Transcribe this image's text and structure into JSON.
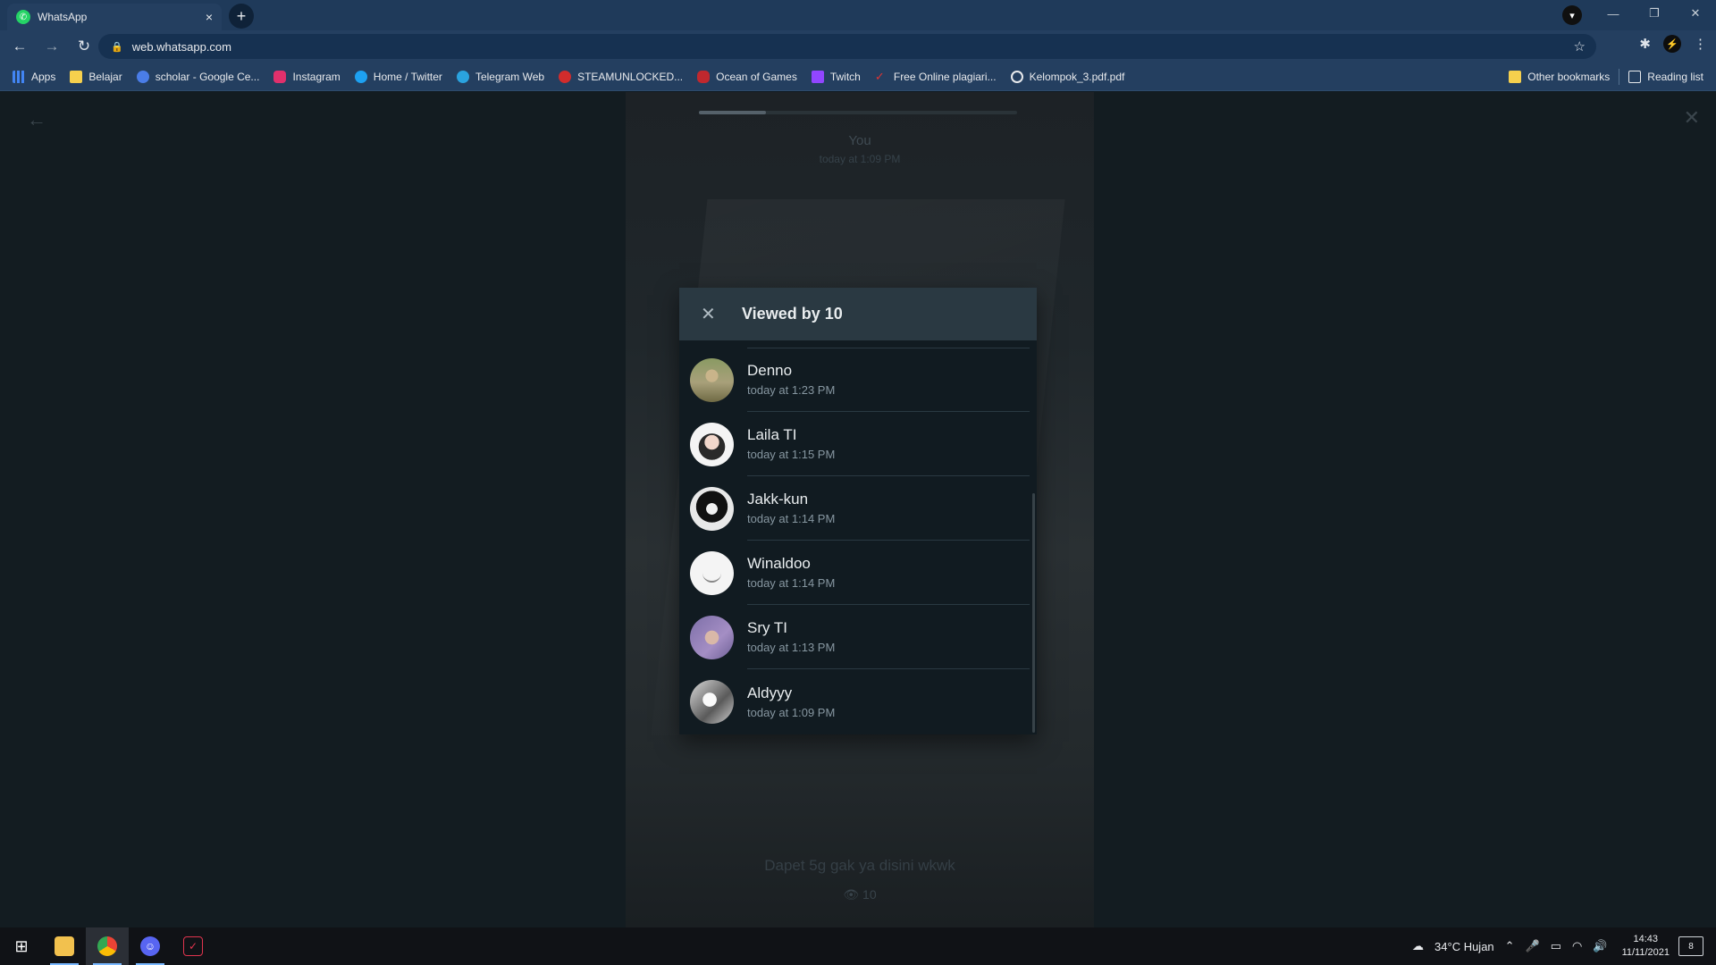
{
  "browser": {
    "tab": {
      "title": "WhatsApp",
      "favicon": "whatsapp-icon",
      "close": "×"
    },
    "new_tab": "+",
    "url": "web.whatsapp.com",
    "bookmarks": [
      {
        "label": "Apps",
        "icon": "apps-grid-icon",
        "color": "#4285f4"
      },
      {
        "label": "Belajar",
        "icon": "folder-icon",
        "color": "#f6d04d"
      },
      {
        "label": "scholar - Google Ce...",
        "icon": "scholar-icon",
        "color": "#4a7de8"
      },
      {
        "label": "Instagram",
        "icon": "instagram-icon",
        "color": "#e1306c"
      },
      {
        "label": "Home / Twitter",
        "icon": "twitter-icon",
        "color": "#1da1f2"
      },
      {
        "label": "Telegram Web",
        "icon": "telegram-icon",
        "color": "#2aa3df"
      },
      {
        "label": "STEAMUNLOCKED...",
        "icon": "steamunlocked-icon",
        "color": "#d22c2c"
      },
      {
        "label": "Ocean of Games",
        "icon": "gamepad-icon",
        "color": "#c0282e"
      },
      {
        "label": "Twitch",
        "icon": "twitch-icon",
        "color": "#9146ff"
      },
      {
        "label": "Free Online plagiari...",
        "icon": "checkmark-icon",
        "color": "#d33"
      },
      {
        "label": "Kelompok_3.pdf.pdf",
        "icon": "globe-icon",
        "color": "#e8eaed"
      }
    ],
    "other_bookmarks": "Other bookmarks",
    "reading_list": "Reading list"
  },
  "status": {
    "poster": "You",
    "posted_time": "today at 1:09 PM",
    "progress_fraction": 0.21,
    "caption": "Dapet 5g gak ya disini wkwk",
    "view_count": "10"
  },
  "dialog": {
    "title": "Viewed by 10",
    "viewers": [
      {
        "name": "Denno",
        "time": "today at 1:23 PM"
      },
      {
        "name": "Laila TI",
        "time": "today at 1:15 PM"
      },
      {
        "name": "Jakk-kun",
        "time": "today at 1:14 PM"
      },
      {
        "name": "Winaldoo",
        "time": "today at 1:14 PM"
      },
      {
        "name": "Sry TI",
        "time": "today at 1:13 PM"
      },
      {
        "name": "Aldyyy",
        "time": "today at 1:09 PM"
      }
    ]
  },
  "taskbar": {
    "weather": "34°C  Hujan",
    "time": "14:43",
    "date": "11/11/2021",
    "notifications": "8"
  }
}
